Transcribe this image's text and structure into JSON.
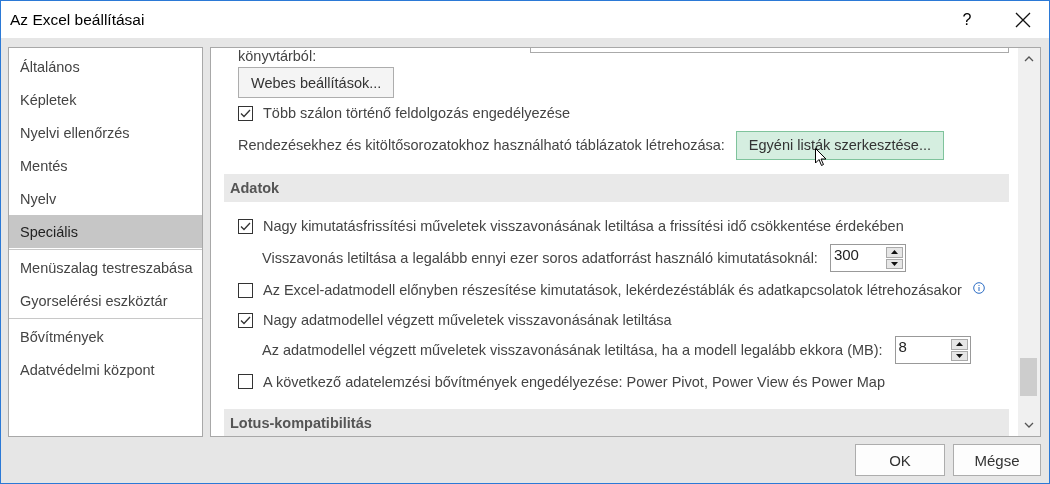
{
  "window": {
    "title": "Az Excel beállításai",
    "help": "?"
  },
  "sidebar": {
    "groups": [
      [
        {
          "label": "Általános",
          "selected": false
        },
        {
          "label": "Képletek",
          "selected": false
        },
        {
          "label": "Nyelvi ellenőrzés",
          "selected": false
        },
        {
          "label": "Mentés",
          "selected": false
        },
        {
          "label": "Nyelv",
          "selected": false
        },
        {
          "label": "Speciális",
          "selected": true
        }
      ],
      [
        {
          "label": "Menüszalag testreszabása",
          "selected": false
        },
        {
          "label": "Gyorselérési eszköztár",
          "selected": false
        }
      ],
      [
        {
          "label": "Bővítmények",
          "selected": false
        },
        {
          "label": "Adatvédelmi központ",
          "selected": false
        }
      ]
    ]
  },
  "content": {
    "top_label": "könyvtárból:",
    "web_options_button": "Webes beállítások...",
    "multithread": {
      "label": "Több szálon történő feldolgozás engedélyezése",
      "checked": true
    },
    "custom_lists": {
      "label": "Rendezésekhez és kitöltősorozatokhoz használható táblázatok létrehozása:",
      "button": "Egyéni listák szerkesztése...",
      "hovered": true
    },
    "sections": [
      {
        "title": "Adatok",
        "items": [
          {
            "kind": "checkbox",
            "label": "Nagy kimutatásfrissítési műveletek visszavonásának letiltása a frissítési idő csökkentése érdekében",
            "checked": true
          },
          {
            "kind": "spin",
            "label": "Visszavonás letiltása a legalább ennyi ezer soros adatforrást használó kimutatásoknál:",
            "value": "300"
          },
          {
            "kind": "checkbox",
            "label": "Az Excel-adatmodell előnyben részesítése kimutatások, lekérdezéstáblák és adatkapcsolatok létrehozásakor",
            "checked": false,
            "info": true
          },
          {
            "kind": "checkbox",
            "label": "Nagy adatmodellel végzett műveletek visszavonásának letiltása",
            "checked": true
          },
          {
            "kind": "spin",
            "label": "Az adatmodellel végzett műveletek visszavonásának letiltása, ha a modell legalább ekkora (MB):",
            "value": "8"
          },
          {
            "kind": "checkbox",
            "label": "A következő adatelemzési bővítmények engedélyezése: Power Pivot, Power View és Power Map",
            "checked": false
          }
        ]
      },
      {
        "title": "Lotus-kompatibilitás"
      }
    ]
  },
  "buttons": [
    "OK",
    "Mégse"
  ]
}
